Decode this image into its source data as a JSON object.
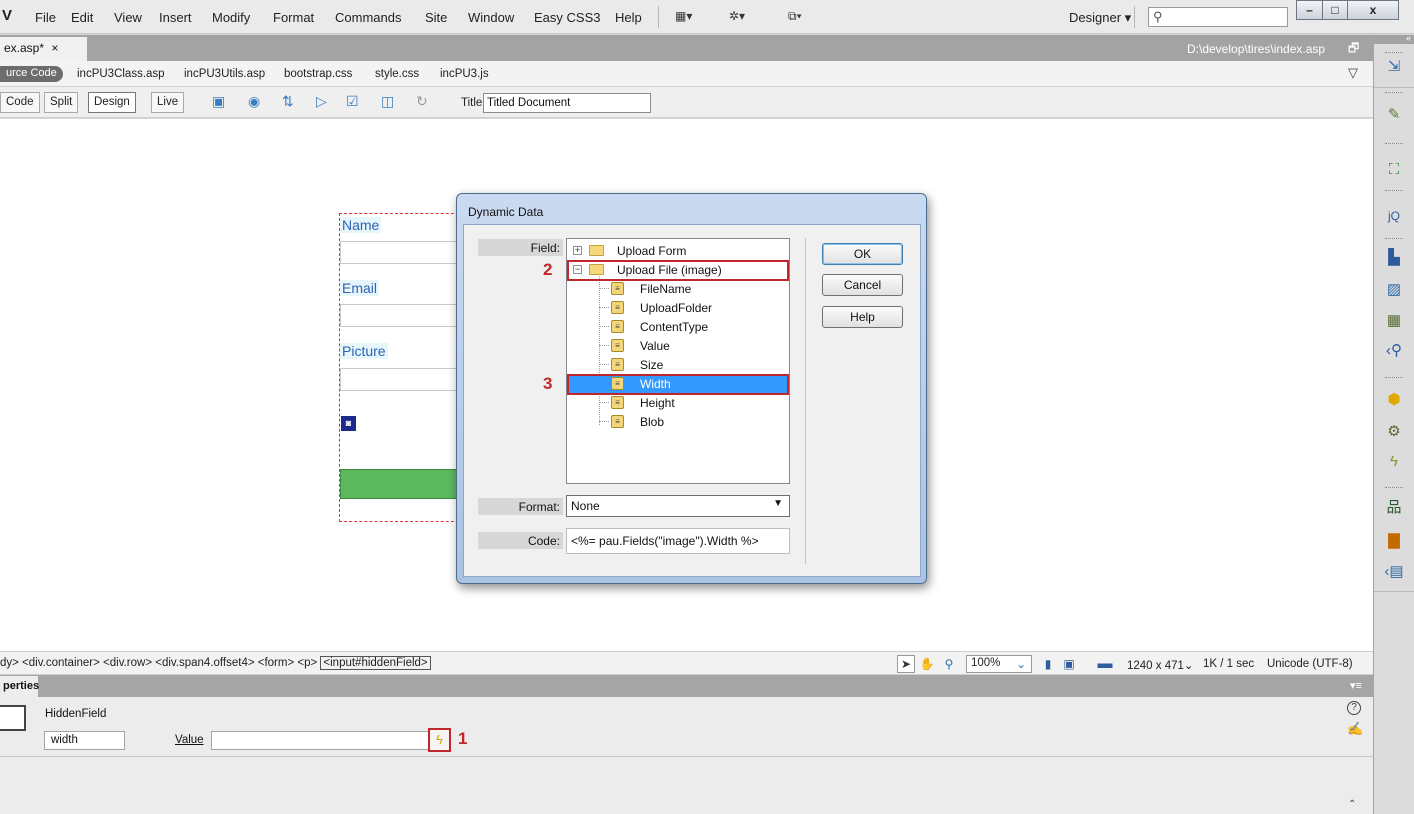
{
  "menubar": {
    "logo": "V",
    "items": [
      "File",
      "Edit",
      "View",
      "Insert",
      "Modify",
      "Format",
      "Commands",
      "Site",
      "Window",
      "Easy CSS3",
      "Help"
    ],
    "tool_icons": [
      "layout-icon",
      "gear-icon",
      "site-icon"
    ],
    "workspace": "Designer",
    "workspace_arrow": "▾",
    "search_placeholder": ""
  },
  "window_controls": {
    "minimize": "–",
    "maximize": "□",
    "close": "x"
  },
  "document": {
    "tab_label": "ex.asp*",
    "tab_close": "×",
    "path": "D:\\develop\\tires\\index.asp"
  },
  "related_files": {
    "source_code": "urce Code",
    "files": [
      "incPU3Class.asp",
      "incPU3Utils.asp",
      "bootstrap.css",
      "style.css",
      "incPU3.js"
    ]
  },
  "doc_toolbar": {
    "views": [
      "Code",
      "Split",
      "Design",
      "Live"
    ],
    "active_view": "Design",
    "title_label": "Title:",
    "title_value": "Titled Document"
  },
  "canvas": {
    "labels": [
      "Name",
      "Email",
      "Picture"
    ],
    "hidden_field_icon": "◙"
  },
  "dialog": {
    "title": "Dynamic Data",
    "field_label": "Field:",
    "tree": [
      {
        "label": "Upload Form",
        "level": 0,
        "expander": "+",
        "kind": "folder"
      },
      {
        "label": "Upload File (image)",
        "level": 0,
        "expander": "−",
        "kind": "folder"
      },
      {
        "label": "FileName",
        "level": 1,
        "kind": "field"
      },
      {
        "label": "UploadFolder",
        "level": 1,
        "kind": "field"
      },
      {
        "label": "ContentType",
        "level": 1,
        "kind": "field"
      },
      {
        "label": "Value",
        "level": 1,
        "kind": "field"
      },
      {
        "label": "Size",
        "level": 1,
        "kind": "field"
      },
      {
        "label": "Width",
        "level": 1,
        "kind": "field",
        "selected": true
      },
      {
        "label": "Height",
        "level": 1,
        "kind": "field"
      },
      {
        "label": "Blob",
        "level": 1,
        "kind": "field"
      }
    ],
    "buttons": {
      "ok": "OK",
      "cancel": "Cancel",
      "help": "Help"
    },
    "format_label": "Format:",
    "format_value": "None",
    "format_arrow": "▼",
    "code_label": "Code:",
    "code_value": "<%= pau.Fields(\"image\").Width %>"
  },
  "annotations": {
    "step1": "1",
    "step2": "2",
    "step3": "3"
  },
  "statusbar": {
    "tag_path": "dy> <div.container> <div.row> <div.span4.offset4> <form> <p> ",
    "selected_tag": "<input#hiddenField>",
    "zoom": "100%",
    "zoom_arrow": "⌄",
    "dimensions": "1240 x 471",
    "dimensions_arrow": "⌄",
    "download": "1K / 1 sec",
    "encoding": "Unicode (UTF-8)"
  },
  "properties": {
    "title": "perties",
    "menu_icon": "▾≡",
    "element_type": "HiddenField",
    "name_value": "width",
    "value_label": "Value",
    "value_value": "",
    "help_icon": "?",
    "collapse_icon": "⌃"
  },
  "colors": {
    "annotation_red": "#c0272d",
    "selection_blue": "#3399ff",
    "form_label_blue": "#2b63b6",
    "submit_green": "#5cb85c"
  }
}
